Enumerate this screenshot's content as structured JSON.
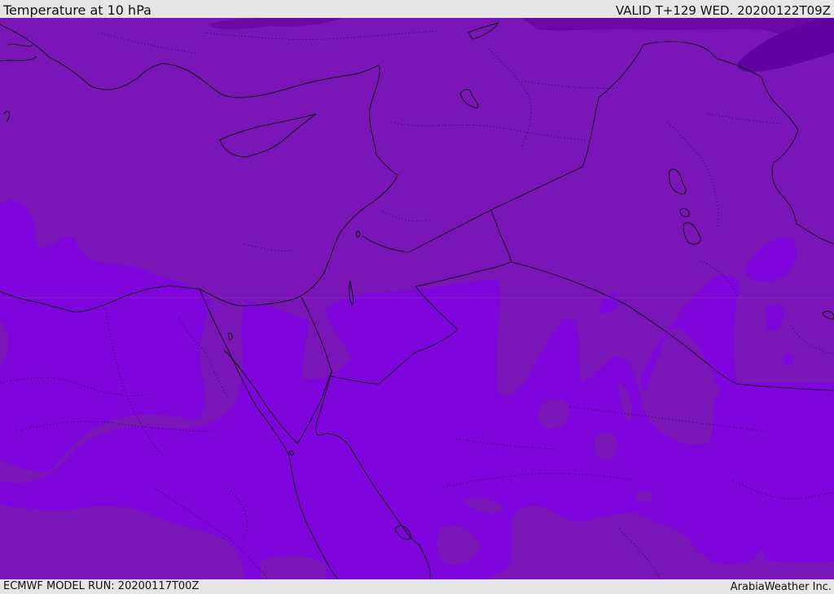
{
  "header": {
    "title": "Temperature at 10 hPa",
    "valid_time": "VALID T+129 WED. 20200122T09Z"
  },
  "footer": {
    "model_run": "ECMWF MODEL RUN: 20200117T00Z",
    "brand": "ArabiaWeather Inc."
  },
  "colors": {
    "field_warm": "#7a16b8",
    "field_bright": "#7e05dc",
    "field_dark": "#6c08a6",
    "field_darkest": "#6300a0",
    "coast": "#111111",
    "border": "#1a0a2a"
  }
}
